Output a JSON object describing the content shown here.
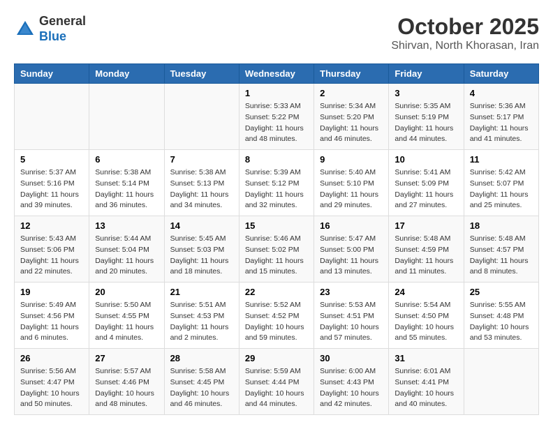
{
  "header": {
    "logo_line1": "General",
    "logo_line2": "Blue",
    "month": "October 2025",
    "location": "Shirvan, North Khorasan, Iran"
  },
  "weekdays": [
    "Sunday",
    "Monday",
    "Tuesday",
    "Wednesday",
    "Thursday",
    "Friday",
    "Saturday"
  ],
  "weeks": [
    [
      {
        "day": "",
        "info": ""
      },
      {
        "day": "",
        "info": ""
      },
      {
        "day": "",
        "info": ""
      },
      {
        "day": "1",
        "info": "Sunrise: 5:33 AM\nSunset: 5:22 PM\nDaylight: 11 hours\nand 48 minutes."
      },
      {
        "day": "2",
        "info": "Sunrise: 5:34 AM\nSunset: 5:20 PM\nDaylight: 11 hours\nand 46 minutes."
      },
      {
        "day": "3",
        "info": "Sunrise: 5:35 AM\nSunset: 5:19 PM\nDaylight: 11 hours\nand 44 minutes."
      },
      {
        "day": "4",
        "info": "Sunrise: 5:36 AM\nSunset: 5:17 PM\nDaylight: 11 hours\nand 41 minutes."
      }
    ],
    [
      {
        "day": "5",
        "info": "Sunrise: 5:37 AM\nSunset: 5:16 PM\nDaylight: 11 hours\nand 39 minutes."
      },
      {
        "day": "6",
        "info": "Sunrise: 5:38 AM\nSunset: 5:14 PM\nDaylight: 11 hours\nand 36 minutes."
      },
      {
        "day": "7",
        "info": "Sunrise: 5:38 AM\nSunset: 5:13 PM\nDaylight: 11 hours\nand 34 minutes."
      },
      {
        "day": "8",
        "info": "Sunrise: 5:39 AM\nSunset: 5:12 PM\nDaylight: 11 hours\nand 32 minutes."
      },
      {
        "day": "9",
        "info": "Sunrise: 5:40 AM\nSunset: 5:10 PM\nDaylight: 11 hours\nand 29 minutes."
      },
      {
        "day": "10",
        "info": "Sunrise: 5:41 AM\nSunset: 5:09 PM\nDaylight: 11 hours\nand 27 minutes."
      },
      {
        "day": "11",
        "info": "Sunrise: 5:42 AM\nSunset: 5:07 PM\nDaylight: 11 hours\nand 25 minutes."
      }
    ],
    [
      {
        "day": "12",
        "info": "Sunrise: 5:43 AM\nSunset: 5:06 PM\nDaylight: 11 hours\nand 22 minutes."
      },
      {
        "day": "13",
        "info": "Sunrise: 5:44 AM\nSunset: 5:04 PM\nDaylight: 11 hours\nand 20 minutes."
      },
      {
        "day": "14",
        "info": "Sunrise: 5:45 AM\nSunset: 5:03 PM\nDaylight: 11 hours\nand 18 minutes."
      },
      {
        "day": "15",
        "info": "Sunrise: 5:46 AM\nSunset: 5:02 PM\nDaylight: 11 hours\nand 15 minutes."
      },
      {
        "day": "16",
        "info": "Sunrise: 5:47 AM\nSunset: 5:00 PM\nDaylight: 11 hours\nand 13 minutes."
      },
      {
        "day": "17",
        "info": "Sunrise: 5:48 AM\nSunset: 4:59 PM\nDaylight: 11 hours\nand 11 minutes."
      },
      {
        "day": "18",
        "info": "Sunrise: 5:48 AM\nSunset: 4:57 PM\nDaylight: 11 hours\nand 8 minutes."
      }
    ],
    [
      {
        "day": "19",
        "info": "Sunrise: 5:49 AM\nSunset: 4:56 PM\nDaylight: 11 hours\nand 6 minutes."
      },
      {
        "day": "20",
        "info": "Sunrise: 5:50 AM\nSunset: 4:55 PM\nDaylight: 11 hours\nand 4 minutes."
      },
      {
        "day": "21",
        "info": "Sunrise: 5:51 AM\nSunset: 4:53 PM\nDaylight: 11 hours\nand 2 minutes."
      },
      {
        "day": "22",
        "info": "Sunrise: 5:52 AM\nSunset: 4:52 PM\nDaylight: 10 hours\nand 59 minutes."
      },
      {
        "day": "23",
        "info": "Sunrise: 5:53 AM\nSunset: 4:51 PM\nDaylight: 10 hours\nand 57 minutes."
      },
      {
        "day": "24",
        "info": "Sunrise: 5:54 AM\nSunset: 4:50 PM\nDaylight: 10 hours\nand 55 minutes."
      },
      {
        "day": "25",
        "info": "Sunrise: 5:55 AM\nSunset: 4:48 PM\nDaylight: 10 hours\nand 53 minutes."
      }
    ],
    [
      {
        "day": "26",
        "info": "Sunrise: 5:56 AM\nSunset: 4:47 PM\nDaylight: 10 hours\nand 50 minutes."
      },
      {
        "day": "27",
        "info": "Sunrise: 5:57 AM\nSunset: 4:46 PM\nDaylight: 10 hours\nand 48 minutes."
      },
      {
        "day": "28",
        "info": "Sunrise: 5:58 AM\nSunset: 4:45 PM\nDaylight: 10 hours\nand 46 minutes."
      },
      {
        "day": "29",
        "info": "Sunrise: 5:59 AM\nSunset: 4:44 PM\nDaylight: 10 hours\nand 44 minutes."
      },
      {
        "day": "30",
        "info": "Sunrise: 6:00 AM\nSunset: 4:43 PM\nDaylight: 10 hours\nand 42 minutes."
      },
      {
        "day": "31",
        "info": "Sunrise: 6:01 AM\nSunset: 4:41 PM\nDaylight: 10 hours\nand 40 minutes."
      },
      {
        "day": "",
        "info": ""
      }
    ]
  ]
}
